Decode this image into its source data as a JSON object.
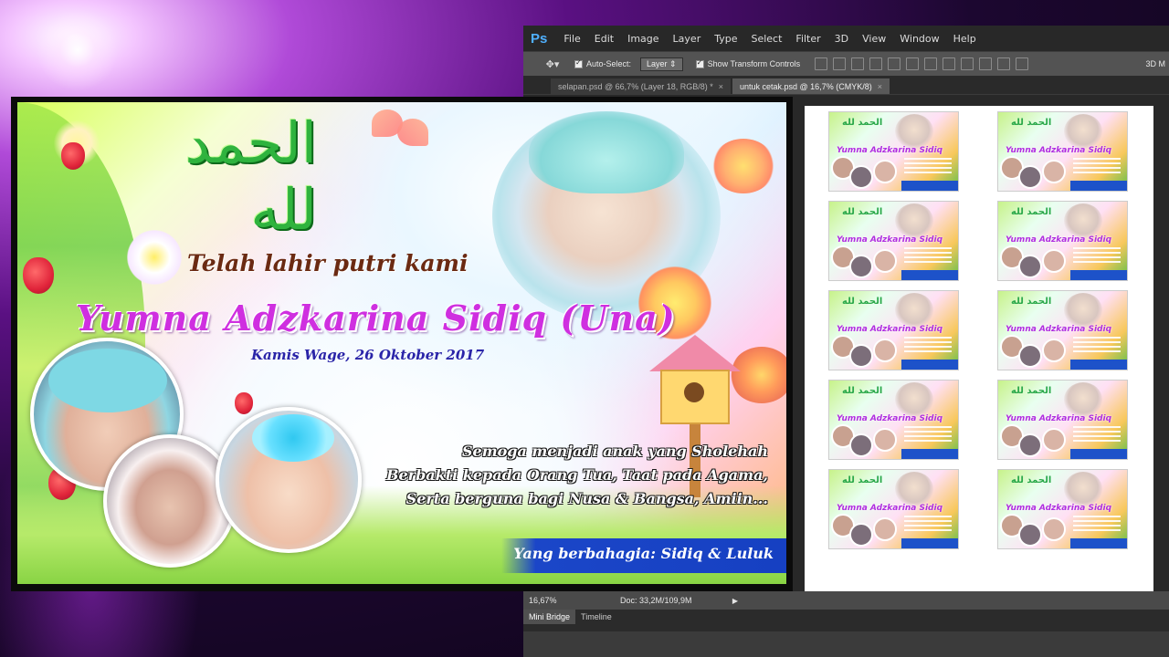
{
  "photoshop": {
    "logo": "Ps",
    "menu": [
      "File",
      "Edit",
      "Image",
      "Layer",
      "Type",
      "Select",
      "Filter",
      "3D",
      "View",
      "Window",
      "Help"
    ],
    "options": {
      "auto_select_label": "Auto-Select:",
      "auto_select_value": "Layer",
      "show_transform_label": "Show Transform Controls",
      "three_d_label": "3D M"
    },
    "tabs": [
      {
        "label": "selapan.psd @ 66,7% (Layer 18, RGB/8) *",
        "active": false
      },
      {
        "label": "untuk cetak.psd @ 16,7% (CMYK/8)",
        "active": true
      }
    ],
    "status": {
      "zoom": "16,67%",
      "doc": "Doc: 33,2M/109,9M",
      "arrow": "▶"
    },
    "panels": [
      "Mini Bridge",
      "Timeline"
    ],
    "thumbnail": {
      "calligraphy": "الحمد لله",
      "name": "Yumna Adzkarina Sidiq"
    }
  },
  "banner": {
    "calligraphy": "الحمد لله",
    "headline": "Telah lahir putri kami",
    "name": "Yumna Adzkarina Sidiq (Una)",
    "date": "Kamis Wage, 26 Oktober 2017",
    "wishes": [
      "Semoga menjadi anak yang Sholehah",
      "Berbakti kepada Orang Tua, Taat pada Agama,",
      "Serta berguna bagi Nusa & Bangsa, Amiin..."
    ],
    "footer": "Yang berbahagia: Sidiq & Luluk"
  },
  "colors": {
    "name": "#cf2fe0",
    "footer_bar": "#1640c2",
    "calligraphy": "#2fb33e",
    "ps_logo": "#4fb0ff"
  }
}
